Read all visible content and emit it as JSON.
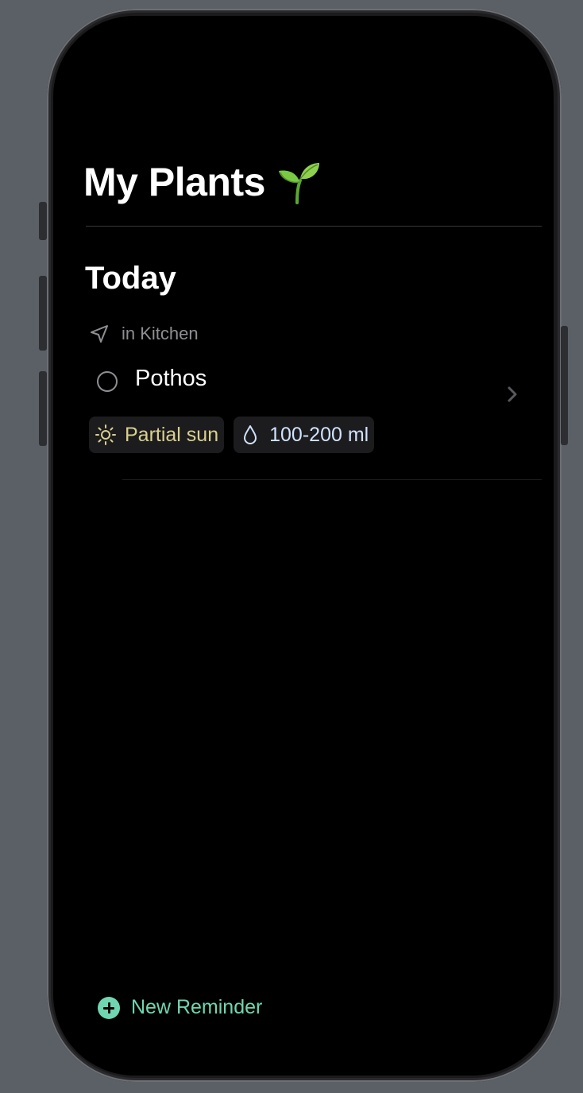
{
  "header": {
    "title": "My Plants",
    "title_emoji_icon": "seedling-icon"
  },
  "section": {
    "title": "Today"
  },
  "items": [
    {
      "location_icon": "location-arrow-icon",
      "location": "in Kitchen",
      "name": "Pothos",
      "tags": [
        {
          "icon": "sun-icon",
          "label": "Partial sun",
          "color": "#d9d08f"
        },
        {
          "icon": "water-drop-icon",
          "label": "100-200 ml",
          "color": "#cfe3ff"
        }
      ]
    }
  ],
  "footer": {
    "new_reminder_label": "New Reminder",
    "accent_color": "#6fd6b1"
  }
}
